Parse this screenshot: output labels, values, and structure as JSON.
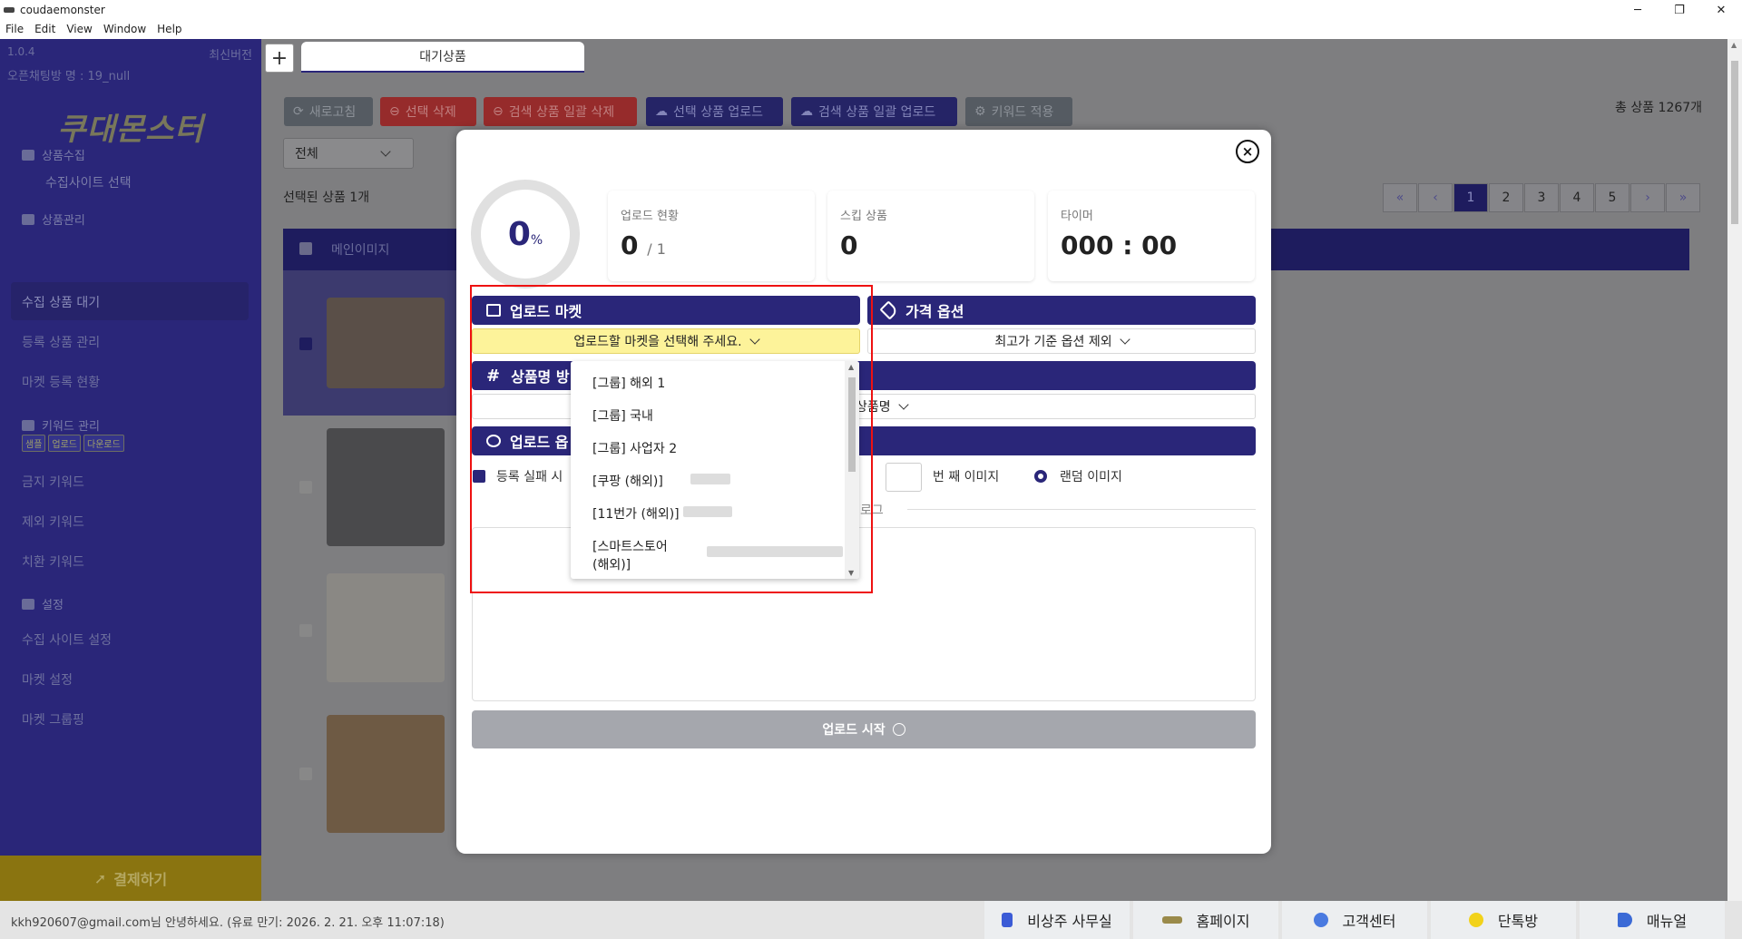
{
  "window": {
    "title": "coudaemonster",
    "min": "─",
    "restore": "❐",
    "close": "✕"
  },
  "menu": [
    "File",
    "Edit",
    "View",
    "Window",
    "Help"
  ],
  "sidebar": {
    "version": "1.0.4",
    "latest": "최신버전",
    "chatroom": "오픈채팅방 명 : 19_null",
    "logo": "쿠대몬스터",
    "sections": {
      "collect": "상품수집",
      "site_select": "수집사이트 선택",
      "manage": "상품관리",
      "keyword": "키워드 관리",
      "settings": "설정"
    },
    "items": {
      "pending": "수집 상품 대기",
      "registered": "등록 상품 관리",
      "market_status": "마켓 등록 현황",
      "banned": "금지 키워드",
      "excluded": "제외 키워드",
      "replace": "치환 키워드",
      "site_settings": "수집 사이트 설정",
      "market_settings": "마켓 설정",
      "market_group": "마켓 그룹핑"
    },
    "tags": [
      "샘플",
      "업로드",
      "다운로드"
    ],
    "pay": "결제하기"
  },
  "tabs": {
    "plus": "+",
    "active": "대기상품"
  },
  "toolbar": {
    "refresh": "새로고침",
    "delete_selected": "선택 삭제",
    "delete_all_search": "검색 상품 일괄 삭제",
    "upload_selected": "선택 상품 업로드",
    "upload_all_search": "검색 상품 일괄 업로드",
    "keyword_apply": "키워드 적용"
  },
  "total_products": "총 상품 1267개",
  "filter": {
    "value": "전체"
  },
  "selected_count": "선택된 상품 1개",
  "pager": [
    "«",
    "‹",
    "1",
    "2",
    "3",
    "4",
    "5",
    "›",
    "»"
  ],
  "table": {
    "col_main_image": "메인이미지"
  },
  "modal": {
    "close": "×",
    "progress_value": "0",
    "progress_unit": "%",
    "upload_status_label": "업로드 현황",
    "upload_status_value": "0",
    "upload_status_total": "/ 1",
    "skip_label": "스킵 상품",
    "skip_value": "0",
    "timer_label": "타이머",
    "timer_value": "000 : 00",
    "upload_market_title": "업로드 마켓",
    "market_placeholder": "업로드할 마켓을 선택해 주세요.",
    "price_option_title": "가격 옵션",
    "price_option_value": "최고가 기준 옵션 제외",
    "product_name_title": "상품명 방",
    "product_name_value": "상품명",
    "upload_option_title": "업로드 옵",
    "fail_label": "등록 실패 시",
    "nth_image": "번 째 이미지",
    "random_image": "랜덤 이미지",
    "log_label": "로그",
    "start": "업로드 시작"
  },
  "dropdown": [
    "[그룹] 해외 1",
    "[그룹] 국내",
    "[그룹] 사업자 2",
    "[쿠팡 (해외)]",
    "[11번가 (해외)]",
    "[스마트스토어",
    "(해외)]"
  ],
  "footer": {
    "user": "kkh920607@gmail.com님 안녕하세요. (유료 만기: 2026. 2. 21. 오후 11:07:18)",
    "emergency": "비상주 사무실",
    "homepage": "홈페이지",
    "support": "고객센터",
    "chat": "단톡방",
    "manual": "매뉴얼"
  }
}
